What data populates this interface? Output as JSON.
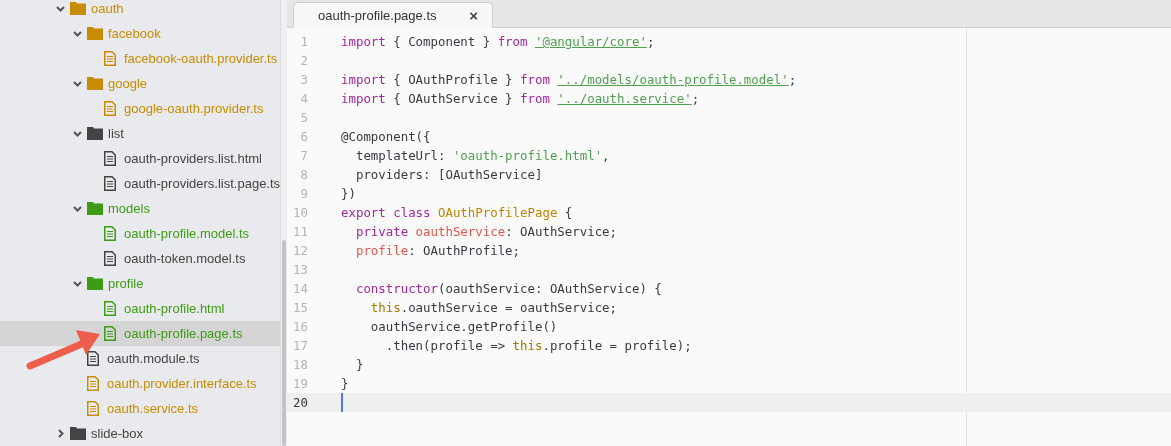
{
  "sidebar": {
    "tree": [
      {
        "kind": "folder",
        "name": "oauth",
        "expanded": true,
        "selected": false,
        "color": "#c98c00",
        "children": [
          {
            "kind": "folder",
            "name": "facebook",
            "expanded": true,
            "selected": false,
            "color": "#c98c00",
            "children": [
              {
                "kind": "file",
                "name": "facebook-oauth.provider.ts",
                "selected": false,
                "color": "#c98c00"
              }
            ]
          },
          {
            "kind": "folder",
            "name": "google",
            "expanded": true,
            "selected": false,
            "color": "#c98c00",
            "children": [
              {
                "kind": "file",
                "name": "google-oauth.provider.ts",
                "selected": false,
                "color": "#c98c00"
              }
            ]
          },
          {
            "kind": "folder",
            "name": "list",
            "expanded": true,
            "selected": false,
            "color": "#444444",
            "children": [
              {
                "kind": "file",
                "name": "oauth-providers.list.html",
                "selected": false,
                "color": "#444444"
              },
              {
                "kind": "file",
                "name": "oauth-providers.list.page.ts",
                "selected": false,
                "color": "#444444"
              }
            ]
          },
          {
            "kind": "folder",
            "name": "models",
            "expanded": true,
            "selected": false,
            "color": "#3e9c14",
            "children": [
              {
                "kind": "file",
                "name": "oauth-profile.model.ts",
                "selected": false,
                "color": "#3e9c14"
              },
              {
                "kind": "file",
                "name": "oauth-token.model.ts",
                "selected": false,
                "color": "#444444"
              }
            ]
          },
          {
            "kind": "folder",
            "name": "profile",
            "expanded": true,
            "selected": false,
            "color": "#3e9c14",
            "children": [
              {
                "kind": "file",
                "name": "oauth-profile.html",
                "selected": false,
                "color": "#3e9c14"
              },
              {
                "kind": "file",
                "name": "oauth-profile.page.ts",
                "selected": true,
                "color": "#3e9c14"
              }
            ]
          },
          {
            "kind": "file",
            "name": "oauth.module.ts",
            "selected": false,
            "color": "#444444"
          },
          {
            "kind": "file",
            "name": "oauth.provider.interface.ts",
            "selected": false,
            "color": "#c98c00"
          },
          {
            "kind": "file",
            "name": "oauth.service.ts",
            "selected": false,
            "color": "#c98c00"
          }
        ]
      },
      {
        "kind": "folder",
        "name": "slide-box",
        "expanded": false,
        "selected": false,
        "color": "#444444"
      }
    ]
  },
  "editor": {
    "tabs": [
      {
        "title": "oauth-profile.page.ts",
        "close": "×",
        "selected": true
      }
    ],
    "lines": [
      {
        "number": "1",
        "current": false,
        "tokens": [
          {
            "kind": "keyword",
            "text": "import "
          },
          {
            "kind": "plain",
            "text": "{ Component } "
          },
          {
            "kind": "keyword",
            "text": "from "
          },
          {
            "kind": "module",
            "text": "'@angular/core'"
          },
          {
            "kind": "plain",
            "text": ";"
          }
        ]
      },
      {
        "number": "2",
        "current": false
      },
      {
        "number": "3",
        "current": false,
        "tokens": [
          {
            "kind": "keyword",
            "text": "import "
          },
          {
            "kind": "plain",
            "text": "{ OAuthProfile } "
          },
          {
            "kind": "keyword",
            "text": "from "
          },
          {
            "kind": "module",
            "text": "'../models/oauth-profile.model'"
          },
          {
            "kind": "plain",
            "text": ";"
          }
        ]
      },
      {
        "number": "4",
        "current": false,
        "tokens": [
          {
            "kind": "keyword",
            "text": "import "
          },
          {
            "kind": "plain",
            "text": "{ OAuthService } "
          },
          {
            "kind": "keyword",
            "text": "from "
          },
          {
            "kind": "module",
            "text": "'../oauth.service'"
          },
          {
            "kind": "plain",
            "text": ";"
          }
        ]
      },
      {
        "number": "5",
        "current": false
      },
      {
        "number": "6",
        "current": false,
        "tokens": [
          {
            "kind": "plain",
            "text": "@Component({"
          }
        ]
      },
      {
        "number": "7",
        "current": false,
        "tokens": [
          {
            "kind": "plain",
            "text": "  templateUrl: "
          },
          {
            "kind": "string",
            "text": "'oauth-profile.html'"
          },
          {
            "kind": "plain",
            "text": ","
          }
        ]
      },
      {
        "number": "8",
        "current": false,
        "tokens": [
          {
            "kind": "plain",
            "text": "  providers: [OAuthService]"
          }
        ]
      },
      {
        "number": "9",
        "current": false,
        "tokens": [
          {
            "kind": "plain",
            "text": "})"
          }
        ]
      },
      {
        "number": "10",
        "current": false,
        "tokens": [
          {
            "kind": "keyword",
            "text": "export class "
          },
          {
            "kind": "class",
            "text": "OAuthProfilePage"
          },
          {
            "kind": "plain",
            "text": " {"
          }
        ]
      },
      {
        "number": "11",
        "current": false,
        "tokens": [
          {
            "kind": "keyword",
            "text": "  private "
          },
          {
            "kind": "property",
            "text": "oauthService"
          },
          {
            "kind": "plain",
            "text": ": OAuthService;"
          }
        ]
      },
      {
        "number": "12",
        "current": false,
        "tokens": [
          {
            "kind": "property",
            "text": "  profile"
          },
          {
            "kind": "plain",
            "text": ": OAuthProfile;"
          }
        ]
      },
      {
        "number": "13",
        "current": false
      },
      {
        "number": "14",
        "current": false,
        "tokens": [
          {
            "kind": "keyword",
            "text": "  constructor"
          },
          {
            "kind": "plain",
            "text": "(oauthService: OAuthService) {"
          }
        ]
      },
      {
        "number": "15",
        "current": false,
        "tokens": [
          {
            "kind": "this",
            "text": "    this"
          },
          {
            "kind": "plain",
            "text": ".oauthService = oauthService;"
          }
        ]
      },
      {
        "number": "16",
        "current": false,
        "tokens": [
          {
            "kind": "plain",
            "text": "    oauthService.getProfile()"
          }
        ]
      },
      {
        "number": "17",
        "current": false,
        "tokens": [
          {
            "kind": "plain",
            "text": "      .then(profile => "
          },
          {
            "kind": "this",
            "text": "this"
          },
          {
            "kind": "plain",
            "text": ".profile = profile);"
          }
        ]
      },
      {
        "number": "18",
        "current": false,
        "tokens": [
          {
            "kind": "plain",
            "text": "  }"
          }
        ]
      },
      {
        "number": "19",
        "current": false,
        "tokens": [
          {
            "kind": "plain",
            "text": "}"
          }
        ]
      },
      {
        "number": "20",
        "current": true
      }
    ]
  }
}
